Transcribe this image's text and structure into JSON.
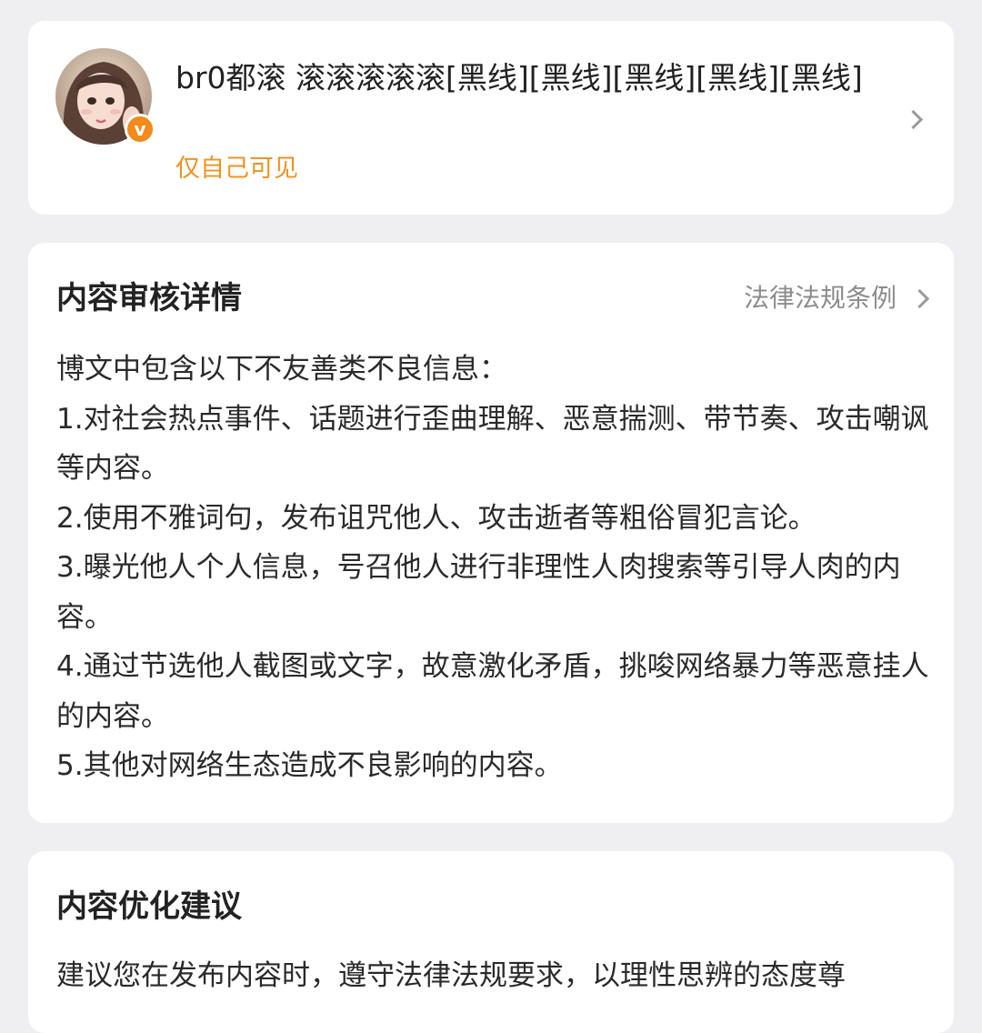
{
  "post": {
    "title": "br0都滚 滚滚滚滚滚[黑线][黑线][黑线][黑线][黑线]",
    "visibility": "仅自己可见",
    "avatar_icon": "user-avatar-photo",
    "verified_badge": "v",
    "accent_color": "#f2921e"
  },
  "review": {
    "title": "内容审核详情",
    "law_link": "法律法规条例",
    "intro": "博文中包含以下不友善类不良信息：",
    "items": [
      "1.对社会热点事件、话题进行歪曲理解、恶意揣测、带节奏、攻击嘲讽等内容。",
      "2.使用不雅词句，发布诅咒他人、攻击逝者等粗俗冒犯言论。",
      "3.曝光他人个人信息，号召他人进行非理性人肉搜索等引导人肉的内容。",
      "4.通过节选他人截图或文字，故意激化矛盾，挑唆网络暴力等恶意挂人的内容。",
      "5.其他对网络生态造成不良影响的内容。"
    ]
  },
  "suggestion": {
    "title": "内容优化建议",
    "text": "建议您在发布内容时，遵守法律法规要求，以理性思辨的态度尊"
  }
}
